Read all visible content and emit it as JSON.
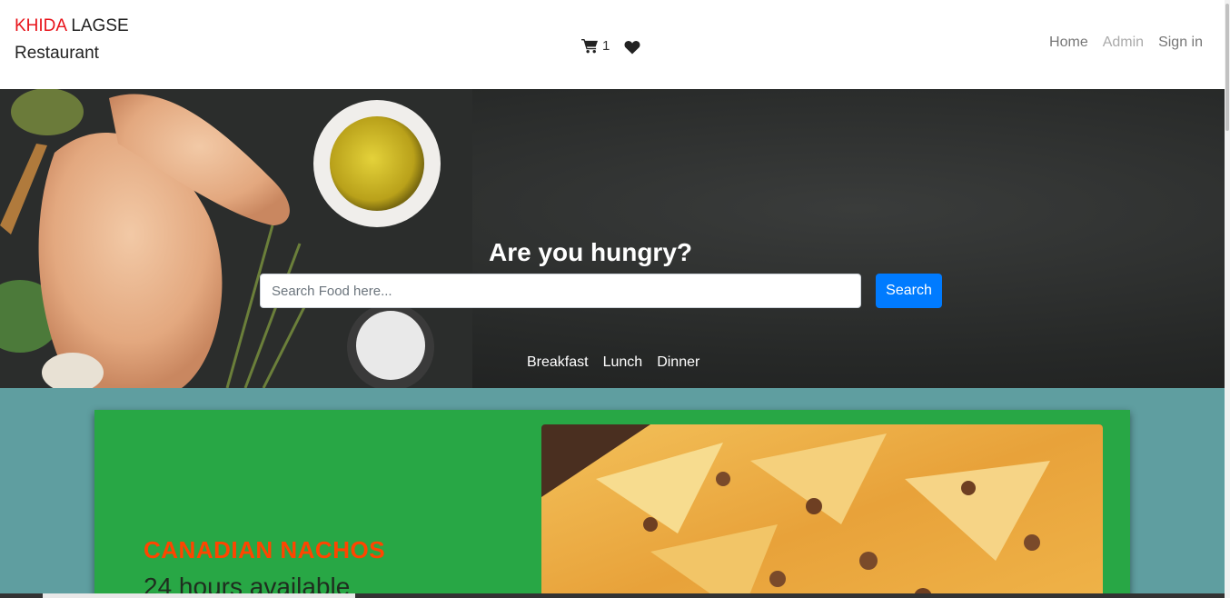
{
  "brand": {
    "part1": "KHIDA",
    "part2": "LAGSE",
    "line2": "Restaurant",
    "accent_color": "#e8141b"
  },
  "header": {
    "cart_icon": "shopping-cart-icon",
    "cart_count": "1",
    "wishlist_icon": "heart-icon"
  },
  "nav": {
    "home": "Home",
    "admin": "Admin",
    "signin": "Sign in"
  },
  "hero": {
    "title": "Are you hungry?",
    "search_placeholder": "Search Food here...",
    "search_button": "Search",
    "tabs": [
      "Breakfast",
      "Lunch",
      "Dinner"
    ]
  },
  "featured": {
    "title": "CANADIAN NACHOS",
    "subtitle": "24 hours available"
  },
  "colors": {
    "hero_bg": "#262827",
    "page_bg": "#5f9ea0",
    "card_bg": "#28a745",
    "title_color": "#ff4500",
    "button": "#007bff"
  }
}
